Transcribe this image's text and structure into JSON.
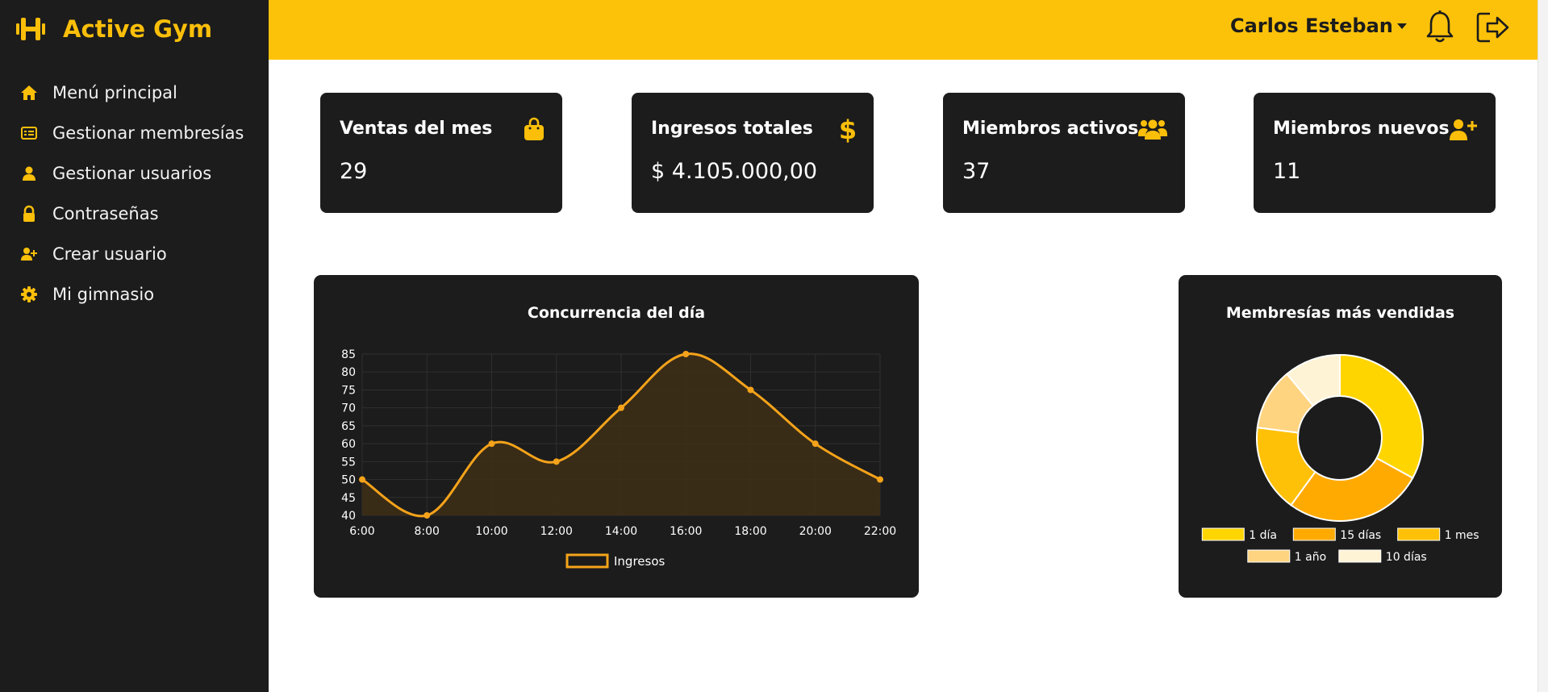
{
  "brand": {
    "name": "Active Gym",
    "icon": "dumbbell-icon",
    "accent": "#fbbf0a"
  },
  "sidebar": {
    "items": [
      {
        "label": "Menú principal",
        "icon": "home-icon"
      },
      {
        "label": "Gestionar membresías",
        "icon": "id-card-icon"
      },
      {
        "label": "Gestionar usuarios",
        "icon": "user-icon"
      },
      {
        "label": "Contraseñas",
        "icon": "lock-icon"
      },
      {
        "label": "Crear usuario",
        "icon": "user-plus-icon"
      },
      {
        "label": "Mi gimnasio",
        "icon": "gear-icon"
      }
    ]
  },
  "header": {
    "user_name": "Carlos Esteban",
    "bar_color": "#fcc20a"
  },
  "stats": [
    {
      "title": "Ventas del mes",
      "value": "29",
      "icon": "shopping-bag-icon"
    },
    {
      "title": "Ingresos totales",
      "value": "$ 4.105.000,00",
      "icon": "dollar-icon"
    },
    {
      "title": "Miembros activos",
      "value": "37",
      "icon": "users-icon"
    },
    {
      "title": "Miembros nuevos",
      "value": "11",
      "icon": "user-plus-icon"
    }
  ],
  "chart_data": [
    {
      "type": "line",
      "title": "Concurrencia del día",
      "x": [
        "6:00",
        "8:00",
        "10:00",
        "12:00",
        "14:00",
        "16:00",
        "18:00",
        "20:00",
        "22:00"
      ],
      "series": [
        {
          "name": "Ingresos",
          "values": [
            50,
            40,
            60,
            55,
            70,
            85,
            75,
            60,
            50
          ],
          "color": "#f5a31a"
        }
      ],
      "ylim": [
        40,
        85
      ],
      "yticks": [
        40,
        45,
        50,
        55,
        60,
        65,
        70,
        75,
        80,
        85
      ],
      "grid": true,
      "legend": "bottom",
      "area_fill": true
    },
    {
      "type": "pie",
      "title": "Membresías más vendidas",
      "labels": [
        "1 día",
        "15 días",
        "1 mes",
        "1 año",
        "10 días"
      ],
      "values": [
        33,
        27,
        17,
        12,
        11
      ],
      "colors": [
        "#ffd500",
        "#ffaa00",
        "#ffc107",
        "#ffd480",
        "#fff3d6"
      ],
      "donut": true,
      "legend": "bottom"
    }
  ]
}
